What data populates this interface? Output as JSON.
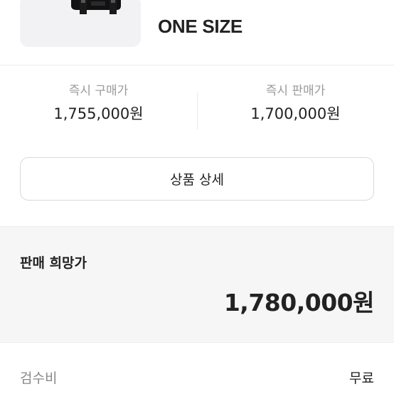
{
  "product": {
    "thumbnail_icon": "bag-image",
    "size": "ONE SIZE"
  },
  "prices": {
    "instant_buy_label": "즉시 구매가",
    "instant_buy_value": "1,755,000원",
    "instant_sell_label": "즉시 판매가",
    "instant_sell_value": "1,700,000원"
  },
  "detail_button": {
    "label": "상품 상세"
  },
  "desired_price": {
    "label": "판매 희망가",
    "value": "1,780,000원"
  },
  "fee": {
    "label": "검수비",
    "value": "무료"
  },
  "colors": {
    "section_bg": "#f6f6f6",
    "thumb_bg": "#f2f2f4",
    "muted_text": "#9a9a9a",
    "primary_text": "#222222"
  }
}
